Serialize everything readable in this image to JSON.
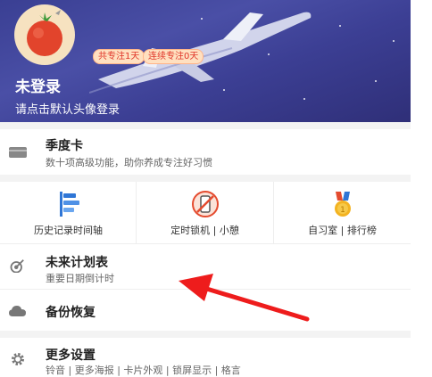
{
  "profile": {
    "username": "未登录",
    "login_hint": "请点击默认头像登录",
    "badge_total": "共专注1天",
    "badge_streak": "连续专注0天"
  },
  "season_card": {
    "title": "季度卡",
    "subtitle": "数十项高级功能，助你养成专注好习惯"
  },
  "features": [
    {
      "label": "历史记录时间轴",
      "icon": "timeline-icon"
    },
    {
      "label": "定时锁机 | 小憩",
      "icon": "phone-lock-icon"
    },
    {
      "label": "自习室 | 排行榜",
      "icon": "medal-icon"
    }
  ],
  "future_plan": {
    "title": "未来计划表",
    "subtitle": "重要日期倒计时"
  },
  "backup": {
    "title": "备份恢复"
  },
  "settings": {
    "title": "更多设置",
    "subtitle": "铃音 | 更多海报 | 卡片外观 | 锁屏显示 | 格言"
  },
  "colors": {
    "header_bg": "#3f4399",
    "badge_text": "#e0362a",
    "arrow": "#ee1c1c"
  }
}
